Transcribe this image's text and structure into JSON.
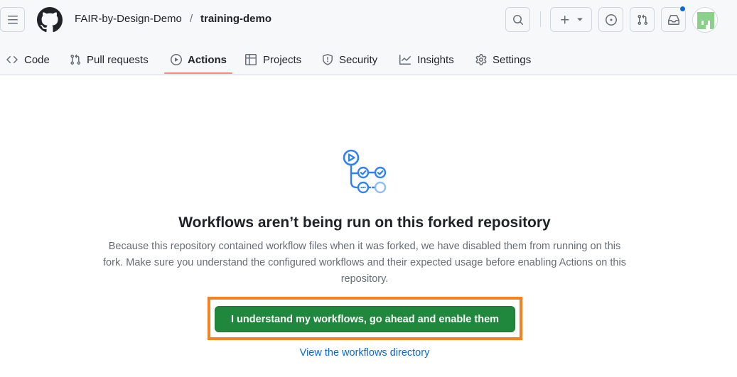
{
  "breadcrumb": {
    "owner": "FAIR-by-Design-Demo",
    "separator": "/",
    "repo": "training-demo"
  },
  "header_icons": [
    "hamburger-icon",
    "github-logo",
    "search-icon",
    "plus-icon",
    "chevron-down-icon",
    "issues-icon",
    "pull-requests-icon",
    "inbox-icon",
    "avatar"
  ],
  "tabs": [
    {
      "label": "Code",
      "icon": "code-icon"
    },
    {
      "label": "Pull requests",
      "icon": "pull-request-icon"
    },
    {
      "label": "Actions",
      "icon": "play-icon",
      "active": true
    },
    {
      "label": "Projects",
      "icon": "table-icon"
    },
    {
      "label": "Security",
      "icon": "shield-icon"
    },
    {
      "label": "Insights",
      "icon": "graph-icon"
    },
    {
      "label": "Settings",
      "icon": "gear-icon"
    }
  ],
  "main": {
    "title": "Workflows aren’t being run on this forked repository",
    "description": "Because this repository contained workflow files when it was forked, we have disabled them from running on this fork. Make sure you understand the configured workflows and their expected usage before enabling Actions on this repository.",
    "enable_button": "I understand my workflows, go ahead and enable them",
    "directory_link": "View the workflows directory"
  },
  "colors": {
    "primary_button": "#1f883d",
    "link": "#0969da",
    "highlight_border": "#f5821f",
    "active_tab_underline": "#fd8c73",
    "illustration": "#2f81f7"
  }
}
